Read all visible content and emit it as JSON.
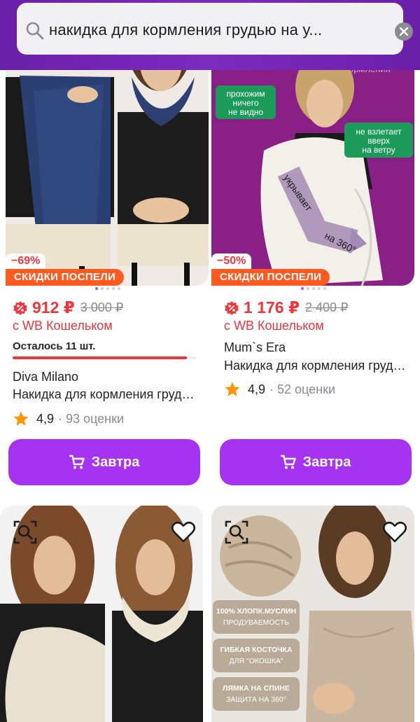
{
  "search": {
    "query": "накидка для кормления грудью на у...",
    "icon": "search-icon",
    "clear_icon": "close-icon"
  },
  "products": [
    {
      "discount": "−69%",
      "sale_badge": "СКИДКИ ПОСПЕЛИ",
      "price": "912 ₽",
      "old_price": "3 000 ₽",
      "wallet": "с WB Кошельком",
      "stock_left": "Осталось 11 шт.",
      "stock_progress": 0.95,
      "brand": "Diva Milano",
      "name": "Накидка для кормления грудью",
      "rating": "4,9",
      "reviews": "· 93 оценки",
      "button": "Завтра"
    },
    {
      "discount": "−50%",
      "sale_badge": "СКИДКИ ПОСПЕЛИ",
      "price": "1 176 ₽",
      "old_price": "2 400 ₽",
      "wallet": "с WB Кошельком",
      "brand": "Mum`s Era",
      "name": "Накидка для кормления грудью",
      "rating": "4,9",
      "reviews": "· 52 оценки",
      "button": "Завтра",
      "image_text": {
        "top": "для кормления",
        "left": [
          "прохожим",
          "ничего",
          "не видно"
        ],
        "right": [
          "не взлетает",
          "вверх",
          "на ветру"
        ],
        "arrow1": "укрывает",
        "arrow2": "на 360°"
      }
    }
  ],
  "row2": {
    "right_image_text": [
      "100% ХЛОПК.МУСЛИН",
      "ПРОДУВАЕМОСТЬ",
      "ГИБКАЯ КОСТОЧКА",
      "ДЛЯ \"ОКОШКА\"",
      "ЛЯМКА НА СПИНЕ",
      "ЗАЩИТА НА 360°"
    ]
  },
  "colors": {
    "accent": "#a733f2",
    "header": "#7b2cbf",
    "price": "#f0353b",
    "sale_badge": "#ff5a1f",
    "star": "#ff9500"
  }
}
